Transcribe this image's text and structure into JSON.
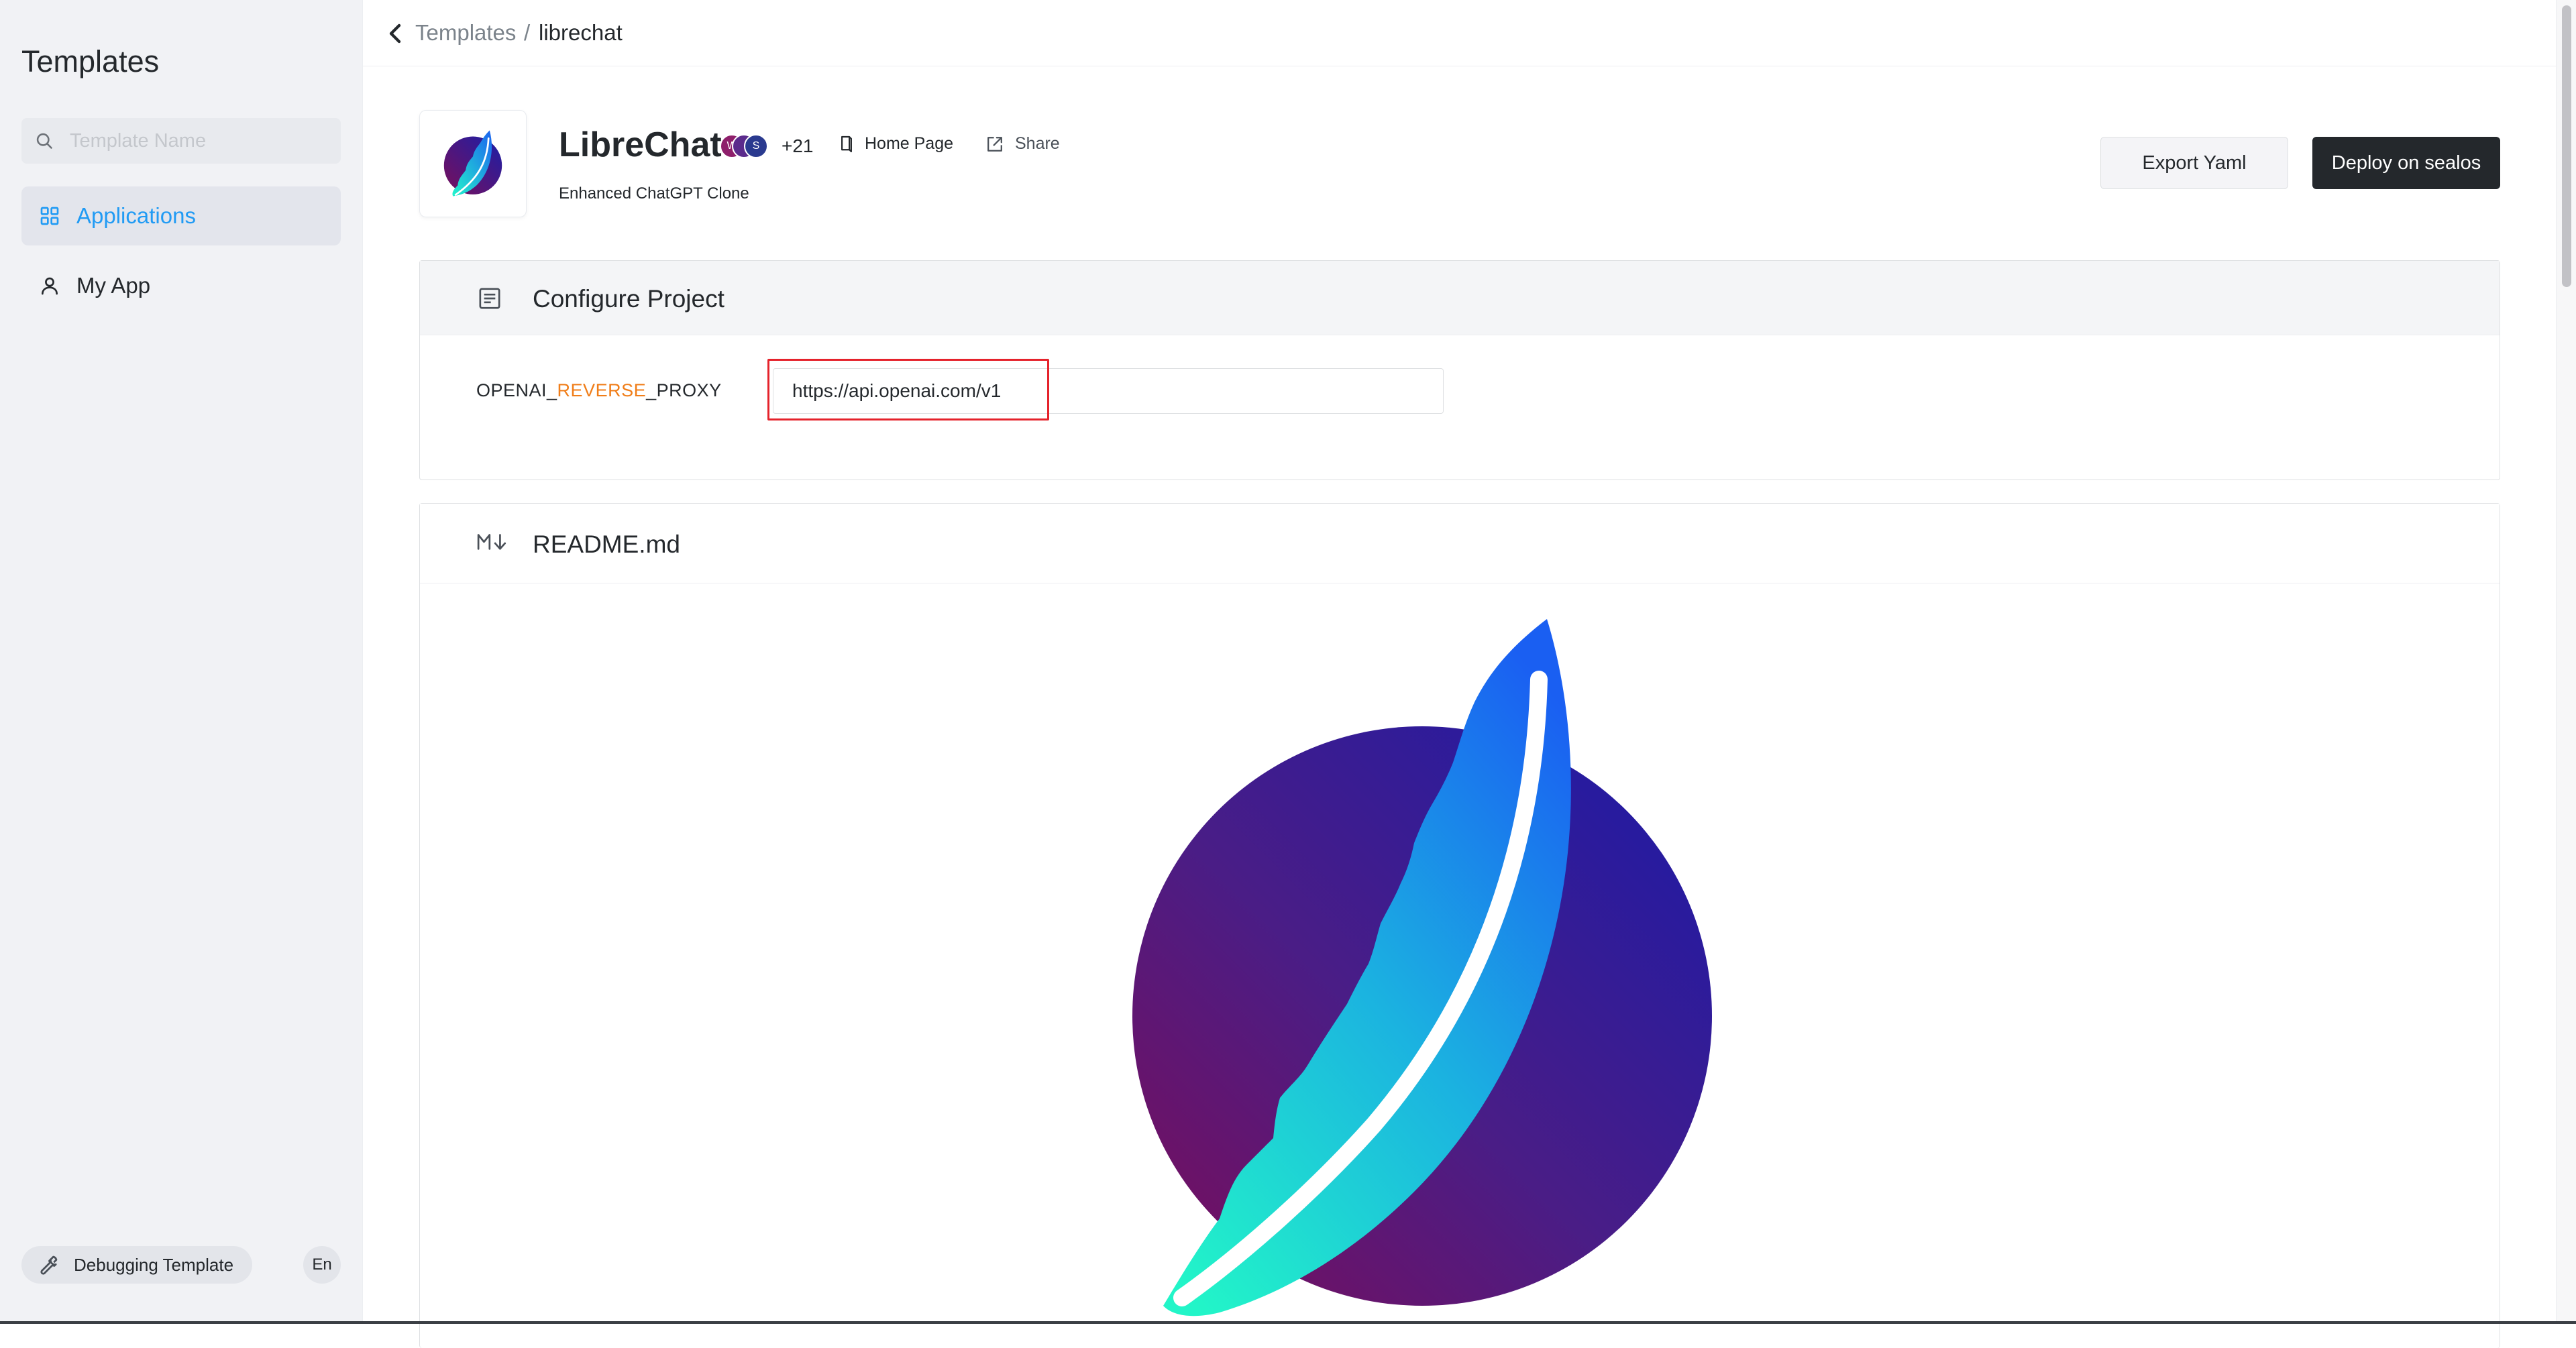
{
  "sidebar": {
    "title": "Templates",
    "search_placeholder": "Template Name",
    "nav": [
      {
        "label": "Applications",
        "icon": "grid-icon",
        "active": true
      },
      {
        "label": "My App",
        "icon": "user-icon",
        "active": false
      }
    ],
    "debug_label": "Debugging Template",
    "lang_label": "En"
  },
  "breadcrumb": {
    "parent": "Templates",
    "separator": "/",
    "current": "librechat"
  },
  "app": {
    "name": "LibreChat",
    "description": "Enhanced ChatGPT Clone",
    "avatars": [
      "W",
      "",
      "S"
    ],
    "avatar_colors": [
      "#8e1f6b",
      "#5b2b8c",
      "#2a3a8f"
    ],
    "extra_count": "+21",
    "home_page_label": "Home Page",
    "share_label": "Share"
  },
  "actions": {
    "export_label": "Export Yaml",
    "deploy_label": "Deploy on sealos"
  },
  "configure": {
    "title": "Configure Project",
    "field_label_prefix": "OPENAI_",
    "field_label_highlight": "REVERSE",
    "field_label_suffix": "_PROXY",
    "field_value": "https://api.openai.com/v1"
  },
  "readme": {
    "title": "README.md"
  },
  "colors": {
    "accent_blue": "#219bf4",
    "primary_dark": "#24282c",
    "highlight_orange": "#f07d18",
    "highlight_red": "#e5222b"
  }
}
